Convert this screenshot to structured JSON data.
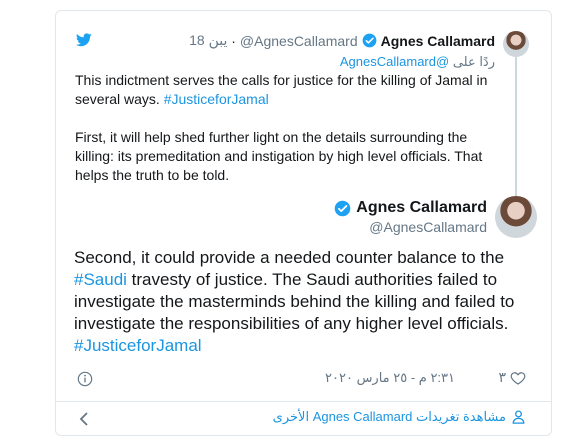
{
  "parent_tweet": {
    "name": "Agnes Callamard",
    "handle": "@AgnesCallamard",
    "time": "18 يبن",
    "replying_prefix": "ردًا على",
    "replying_handle": "@AgnesCallamard",
    "text_part1": "This indictment serves the calls for justice for the killing of Jamal in several ways. ",
    "hashtag": "#JusticeforJamal",
    "text_part2": "\n\nFirst, it will help shed further light on the details surrounding the killing: its premeditation and instigation by high level officials.  That helps the truth to be told."
  },
  "main_tweet": {
    "name": "Agnes Callamard",
    "handle": "@AgnesCallamard",
    "text_part1": "Second, it could provide a needed counter balance to the ",
    "hashtag1": "#Saudi",
    "text_part2": " travesty of justice. The Saudi authorities failed to investigate the masterminds behind the killing and failed to investigate the responsibilities of any higher level officials. ",
    "hashtag2": "#JusticeforJamal",
    "date": "٢:٣١ م - ٢٥ مارس ٢٠٢٠",
    "likes": "٣"
  },
  "footer": {
    "more_tweets": "مشاهدة تغريدات Agnes Callamard الأخرى"
  },
  "colors": {
    "link": "#1b95e0",
    "muted": "#657786",
    "border": "#e1e8ed"
  },
  "icons": [
    "twitter-bird-icon",
    "verified-badge-icon",
    "info-icon",
    "heart-icon",
    "chevron-left-icon",
    "person-icon"
  ]
}
